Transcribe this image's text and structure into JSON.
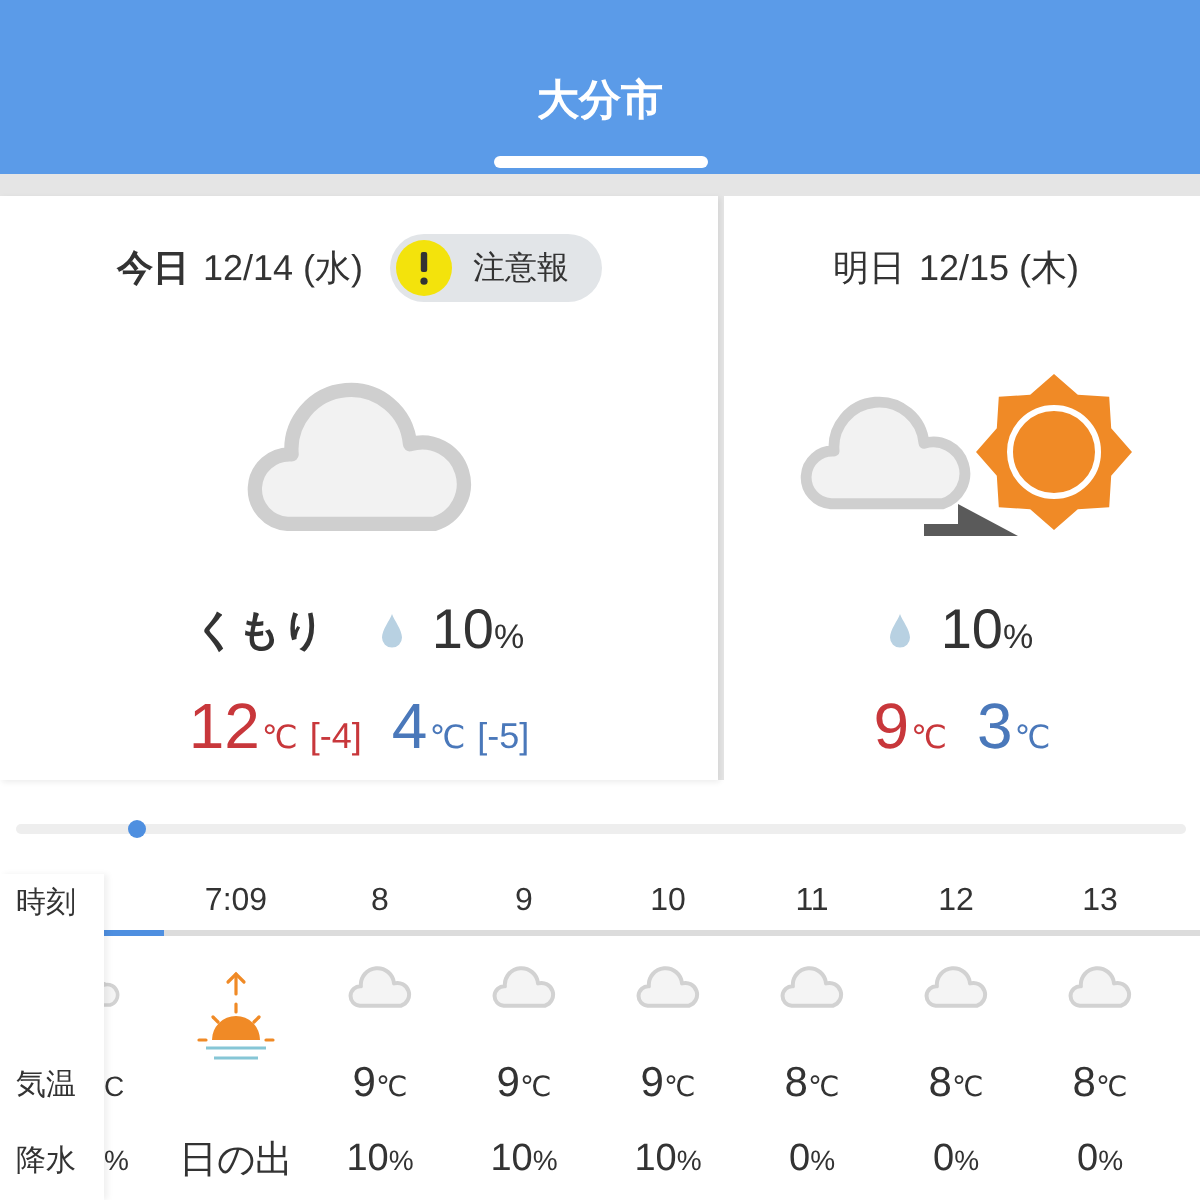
{
  "tabs": [
    {
      "label": "大分市",
      "selected": true
    }
  ],
  "days": [
    {
      "day": "今日",
      "date": "12/14 (水)",
      "today": true,
      "advisory": {
        "label": "注意報"
      },
      "icon": {
        "kind": "cloudy"
      },
      "condition": "くもり",
      "precip": "10",
      "precip_unit": "%",
      "high": "12",
      "high_unit": "℃",
      "high_diff": "[-4]",
      "low": "4",
      "low_unit": "℃",
      "low_diff": "[-5]"
    },
    {
      "day": "明日",
      "date": "12/15 (木)",
      "today": false,
      "icon": {
        "kind": "cloudy_then_sunny"
      },
      "precip": "10",
      "precip_unit": "%",
      "high": "9",
      "high_unit": "℃",
      "low": "3",
      "low_unit": "℃"
    }
  ],
  "hourly": {
    "row_labels": [
      {
        "kind": "time",
        "label": "時刻"
      },
      {
        "kind": "temp",
        "label": "気温"
      },
      {
        "kind": "precip",
        "label": "降水"
      }
    ],
    "hours": [
      {
        "kind": "clipped",
        "current": true,
        "icon": {
          "kind": "cloudy"
        },
        "temp_unit": "C",
        "precip_unit": "%"
      },
      {
        "kind": "sunrise",
        "current": false,
        "time": "7:09",
        "icon": {
          "kind": "sunrise"
        },
        "note": "日の出"
      },
      {
        "kind": "hour",
        "current": false,
        "time": "8",
        "icon": {
          "kind": "cloudy"
        },
        "temp": "9",
        "temp_unit": "℃",
        "precip": "10",
        "precip_unit": "%"
      },
      {
        "kind": "hour",
        "current": false,
        "time": "9",
        "icon": {
          "kind": "cloudy"
        },
        "temp": "9",
        "temp_unit": "℃",
        "precip": "10",
        "precip_unit": "%"
      },
      {
        "kind": "hour",
        "current": false,
        "time": "10",
        "icon": {
          "kind": "cloudy"
        },
        "temp": "9",
        "temp_unit": "℃",
        "precip": "10",
        "precip_unit": "%"
      },
      {
        "kind": "hour",
        "current": false,
        "time": "11",
        "icon": {
          "kind": "cloudy"
        },
        "temp": "8",
        "temp_unit": "℃",
        "precip": "0",
        "precip_unit": "%"
      },
      {
        "kind": "hour",
        "current": false,
        "time": "12",
        "icon": {
          "kind": "cloudy"
        },
        "temp": "8",
        "temp_unit": "℃",
        "precip": "0",
        "precip_unit": "%"
      },
      {
        "kind": "hour",
        "current": false,
        "time": "13",
        "icon": {
          "kind": "cloudy"
        },
        "temp": "8",
        "temp_unit": "℃",
        "precip": "0",
        "precip_unit": "%"
      }
    ]
  }
}
